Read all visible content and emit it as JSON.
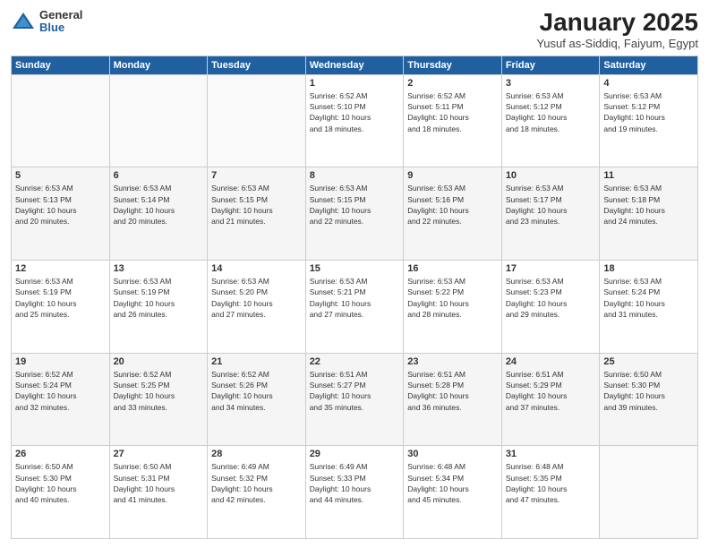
{
  "logo": {
    "general": "General",
    "blue": "Blue"
  },
  "header": {
    "month": "January 2025",
    "location": "Yusuf as-Siddiq, Faiyum, Egypt"
  },
  "days_of_week": [
    "Sunday",
    "Monday",
    "Tuesday",
    "Wednesday",
    "Thursday",
    "Friday",
    "Saturday"
  ],
  "weeks": [
    [
      {
        "num": "",
        "info": ""
      },
      {
        "num": "",
        "info": ""
      },
      {
        "num": "",
        "info": ""
      },
      {
        "num": "1",
        "info": "Sunrise: 6:52 AM\nSunset: 5:10 PM\nDaylight: 10 hours\nand 18 minutes."
      },
      {
        "num": "2",
        "info": "Sunrise: 6:52 AM\nSunset: 5:11 PM\nDaylight: 10 hours\nand 18 minutes."
      },
      {
        "num": "3",
        "info": "Sunrise: 6:53 AM\nSunset: 5:12 PM\nDaylight: 10 hours\nand 18 minutes."
      },
      {
        "num": "4",
        "info": "Sunrise: 6:53 AM\nSunset: 5:12 PM\nDaylight: 10 hours\nand 19 minutes."
      }
    ],
    [
      {
        "num": "5",
        "info": "Sunrise: 6:53 AM\nSunset: 5:13 PM\nDaylight: 10 hours\nand 20 minutes."
      },
      {
        "num": "6",
        "info": "Sunrise: 6:53 AM\nSunset: 5:14 PM\nDaylight: 10 hours\nand 20 minutes."
      },
      {
        "num": "7",
        "info": "Sunrise: 6:53 AM\nSunset: 5:15 PM\nDaylight: 10 hours\nand 21 minutes."
      },
      {
        "num": "8",
        "info": "Sunrise: 6:53 AM\nSunset: 5:15 PM\nDaylight: 10 hours\nand 22 minutes."
      },
      {
        "num": "9",
        "info": "Sunrise: 6:53 AM\nSunset: 5:16 PM\nDaylight: 10 hours\nand 22 minutes."
      },
      {
        "num": "10",
        "info": "Sunrise: 6:53 AM\nSunset: 5:17 PM\nDaylight: 10 hours\nand 23 minutes."
      },
      {
        "num": "11",
        "info": "Sunrise: 6:53 AM\nSunset: 5:18 PM\nDaylight: 10 hours\nand 24 minutes."
      }
    ],
    [
      {
        "num": "12",
        "info": "Sunrise: 6:53 AM\nSunset: 5:19 PM\nDaylight: 10 hours\nand 25 minutes."
      },
      {
        "num": "13",
        "info": "Sunrise: 6:53 AM\nSunset: 5:19 PM\nDaylight: 10 hours\nand 26 minutes."
      },
      {
        "num": "14",
        "info": "Sunrise: 6:53 AM\nSunset: 5:20 PM\nDaylight: 10 hours\nand 27 minutes."
      },
      {
        "num": "15",
        "info": "Sunrise: 6:53 AM\nSunset: 5:21 PM\nDaylight: 10 hours\nand 27 minutes."
      },
      {
        "num": "16",
        "info": "Sunrise: 6:53 AM\nSunset: 5:22 PM\nDaylight: 10 hours\nand 28 minutes."
      },
      {
        "num": "17",
        "info": "Sunrise: 6:53 AM\nSunset: 5:23 PM\nDaylight: 10 hours\nand 29 minutes."
      },
      {
        "num": "18",
        "info": "Sunrise: 6:53 AM\nSunset: 5:24 PM\nDaylight: 10 hours\nand 31 minutes."
      }
    ],
    [
      {
        "num": "19",
        "info": "Sunrise: 6:52 AM\nSunset: 5:24 PM\nDaylight: 10 hours\nand 32 minutes."
      },
      {
        "num": "20",
        "info": "Sunrise: 6:52 AM\nSunset: 5:25 PM\nDaylight: 10 hours\nand 33 minutes."
      },
      {
        "num": "21",
        "info": "Sunrise: 6:52 AM\nSunset: 5:26 PM\nDaylight: 10 hours\nand 34 minutes."
      },
      {
        "num": "22",
        "info": "Sunrise: 6:51 AM\nSunset: 5:27 PM\nDaylight: 10 hours\nand 35 minutes."
      },
      {
        "num": "23",
        "info": "Sunrise: 6:51 AM\nSunset: 5:28 PM\nDaylight: 10 hours\nand 36 minutes."
      },
      {
        "num": "24",
        "info": "Sunrise: 6:51 AM\nSunset: 5:29 PM\nDaylight: 10 hours\nand 37 minutes."
      },
      {
        "num": "25",
        "info": "Sunrise: 6:50 AM\nSunset: 5:30 PM\nDaylight: 10 hours\nand 39 minutes."
      }
    ],
    [
      {
        "num": "26",
        "info": "Sunrise: 6:50 AM\nSunset: 5:30 PM\nDaylight: 10 hours\nand 40 minutes."
      },
      {
        "num": "27",
        "info": "Sunrise: 6:50 AM\nSunset: 5:31 PM\nDaylight: 10 hours\nand 41 minutes."
      },
      {
        "num": "28",
        "info": "Sunrise: 6:49 AM\nSunset: 5:32 PM\nDaylight: 10 hours\nand 42 minutes."
      },
      {
        "num": "29",
        "info": "Sunrise: 6:49 AM\nSunset: 5:33 PM\nDaylight: 10 hours\nand 44 minutes."
      },
      {
        "num": "30",
        "info": "Sunrise: 6:48 AM\nSunset: 5:34 PM\nDaylight: 10 hours\nand 45 minutes."
      },
      {
        "num": "31",
        "info": "Sunrise: 6:48 AM\nSunset: 5:35 PM\nDaylight: 10 hours\nand 47 minutes."
      },
      {
        "num": "",
        "info": ""
      }
    ]
  ]
}
